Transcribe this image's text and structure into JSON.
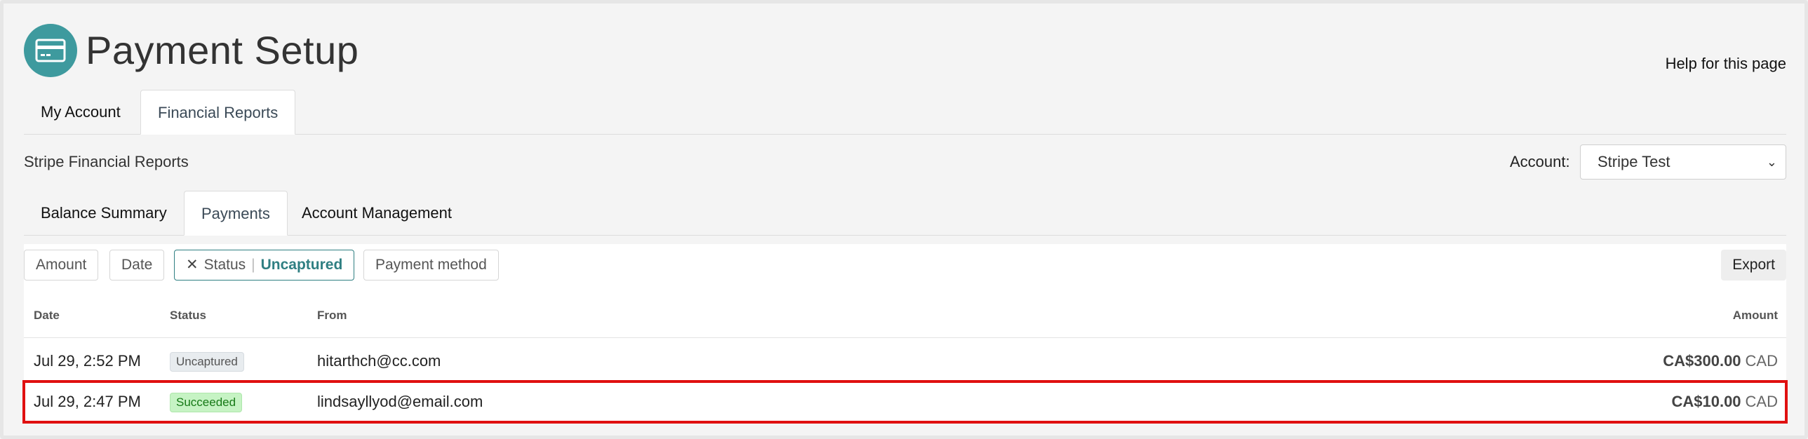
{
  "header": {
    "title": "Payment Setup",
    "help_link": "Help for this page",
    "icon": "credit-card-icon",
    "icon_color": "#3e9a9e"
  },
  "main_tabs": [
    {
      "label": "My Account",
      "active": false
    },
    {
      "label": "Financial Reports",
      "active": true
    }
  ],
  "reports": {
    "title": "Stripe Financial Reports",
    "account_label": "Account:",
    "account_value": "Stripe Test"
  },
  "sub_tabs": [
    {
      "label": "Balance Summary",
      "active": false
    },
    {
      "label": "Payments",
      "active": true
    },
    {
      "label": "Account Management",
      "active": false
    }
  ],
  "filters": {
    "amount": "Amount",
    "date": "Date",
    "status_label": "Status",
    "status_value": "Uncaptured",
    "payment_method": "Payment method",
    "export": "Export"
  },
  "table": {
    "columns": {
      "date": "Date",
      "status": "Status",
      "from": "From",
      "amount": "Amount"
    },
    "rows": [
      {
        "date": "Jul 29, 2:52 PM",
        "status": "Uncaptured",
        "from": "hitarthch@cc.com",
        "amount": "CA$300.00",
        "currency": "CAD"
      },
      {
        "date": "Jul 29, 2:47 PM",
        "status": "Succeeded",
        "from": "lindsayllyod@email.com",
        "amount": "CA$10.00",
        "currency": "CAD"
      }
    ]
  },
  "colors": {
    "accent": "#2f7f82",
    "selection": "#e01010",
    "success": "#177a17"
  }
}
